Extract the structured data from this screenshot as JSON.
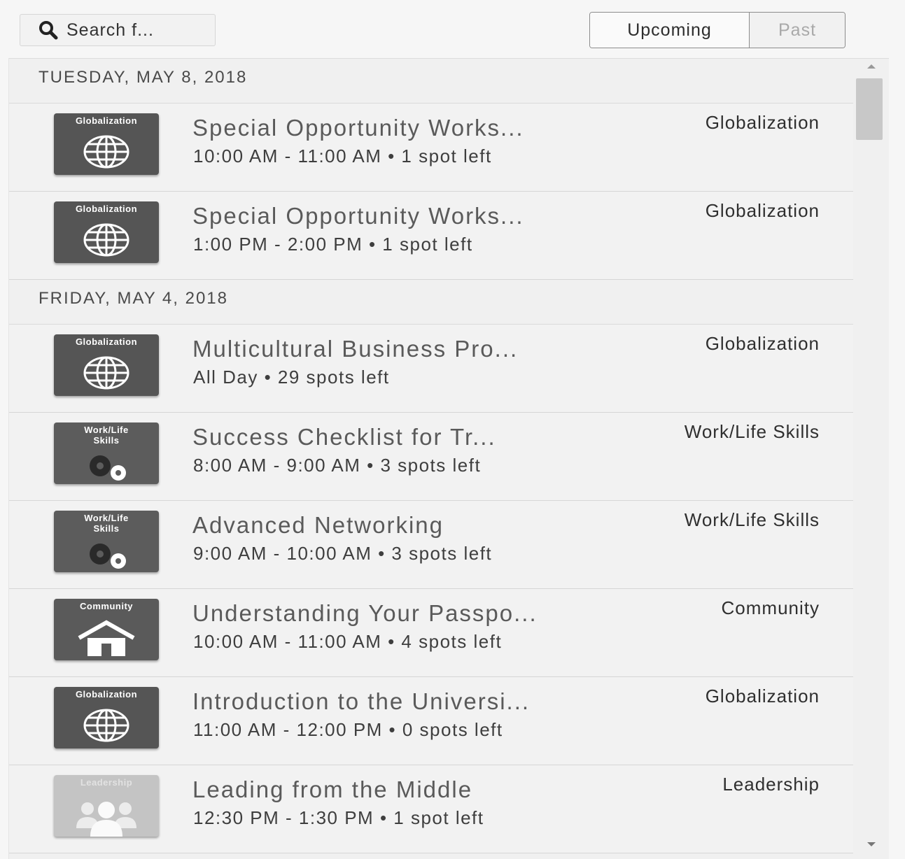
{
  "search": {
    "placeholder": "Search f..."
  },
  "toggle": {
    "upcoming_label": "Upcoming",
    "past_label": "Past",
    "selected": "Upcoming"
  },
  "colors": {
    "globalization": "#555555",
    "worklife": "#5c5c5c",
    "community": "#5a5a5a",
    "leadership": "#c4c4c4",
    "past_label": "#a9a9a9"
  },
  "days": [
    {
      "date": "TUESDAY, MAY 8, 2018",
      "events": [
        {
          "title": "Special Opportunity Works...",
          "meta": "10:00 AM - 11:00 AM • 1 spot left",
          "category": "Globalization",
          "thumb_label": "Globalization",
          "icon": "globe-icon"
        },
        {
          "title": "Special Opportunity Works...",
          "meta": "1:00 PM - 2:00 PM • 1 spot left",
          "category": "Globalization",
          "thumb_label": "Globalization",
          "icon": "globe-icon"
        }
      ]
    },
    {
      "date": "FRIDAY, MAY 4, 2018",
      "events": [
        {
          "title": "Multicultural Business Pro...",
          "meta": "All Day • 29 spots left",
          "category": "Globalization",
          "thumb_label": "Globalization",
          "icon": "globe-icon"
        },
        {
          "title": "Success Checklist for Tr...",
          "meta": "8:00 AM - 9:00 AM • 3 spots left",
          "category": "Work/Life Skills",
          "thumb_label": "Work/Life Skills",
          "icon": "gears-icon"
        },
        {
          "title": "Advanced Networking",
          "meta": "9:00 AM - 10:00 AM • 3 spots left",
          "category": "Work/Life Skills",
          "thumb_label": "Work/Life Skills",
          "icon": "gears-icon"
        },
        {
          "title": "Understanding Your Passpo...",
          "meta": "10:00 AM - 11:00 AM • 4 spots left",
          "category": "Community",
          "thumb_label": "Community",
          "icon": "house-icon"
        },
        {
          "title": "Introduction to the Universi...",
          "meta": "11:00 AM - 12:00 PM • 0 spots left",
          "category": "Globalization",
          "thumb_label": "Globalization",
          "icon": "globe-icon"
        },
        {
          "title": "Leading from the Middle",
          "meta": "12:30 PM - 1:30 PM • 1 spot left",
          "category": "Leadership",
          "thumb_label": "Leadership",
          "icon": "people-icon"
        }
      ]
    }
  ]
}
